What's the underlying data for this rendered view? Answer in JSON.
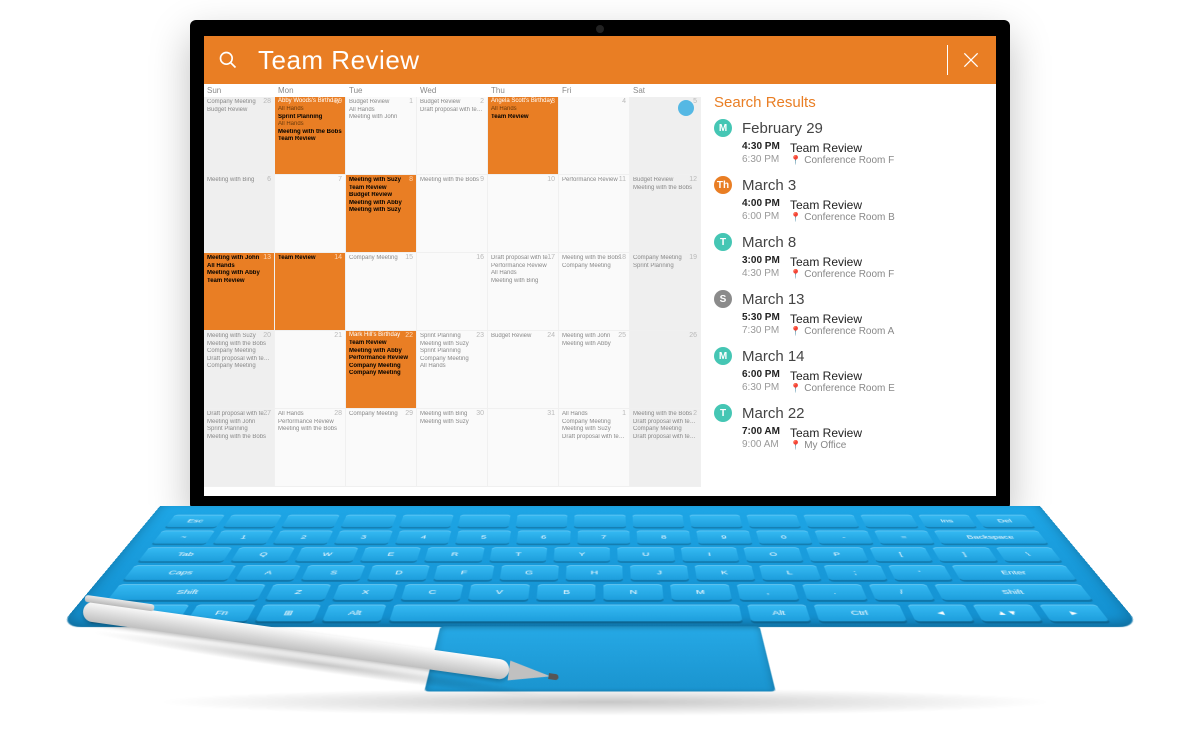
{
  "search": {
    "value": "Team Review"
  },
  "calendar": {
    "dayHeaders": [
      "Sun",
      "Mon",
      "Tue",
      "Wed",
      "Thu",
      "Fri",
      "Sat"
    ],
    "weeks": [
      [
        {
          "n": "28",
          "wknd": true,
          "hl": false,
          "events": [
            {
              "t": "Company Meeting"
            },
            {
              "t": "Budget Review"
            }
          ]
        },
        {
          "n": "29",
          "hl": true,
          "banner": "Abby Woods's Birthday",
          "events": [
            {
              "t": "All Hands"
            },
            {
              "t": "Sprint Planning",
              "hit": true
            },
            {
              "t": "All Hands"
            },
            {
              "t": "Meeting with the Bobs",
              "hit": true
            },
            {
              "t": "Team Review",
              "hit": true
            }
          ]
        },
        {
          "n": "1",
          "events": [
            {
              "t": "Budget Review"
            },
            {
              "t": "All Hands"
            },
            {
              "t": "Meeting with John"
            }
          ]
        },
        {
          "n": "2",
          "events": [
            {
              "t": "Budget Review"
            },
            {
              "t": "Draft proposal with team"
            }
          ]
        },
        {
          "n": "3",
          "hl": true,
          "banner": "Angela Scott's Birthday",
          "events": [
            {
              "t": "All Hands"
            },
            {
              "t": "Team Review",
              "hit": true
            }
          ]
        },
        {
          "n": "4",
          "events": []
        },
        {
          "n": "5",
          "wknd": true,
          "today": true,
          "events": []
        }
      ],
      [
        {
          "n": "6",
          "wknd": true,
          "events": [
            {
              "t": "Meeting with Bing"
            }
          ]
        },
        {
          "n": "7",
          "events": []
        },
        {
          "n": "8",
          "hl": true,
          "events": [
            {
              "t": "Meeting with Suzy",
              "hit": true
            },
            {
              "t": "Team Review",
              "hit": true
            },
            {
              "t": "Budget Review",
              "hit": true
            },
            {
              "t": "Meeting with Abby",
              "hit": true
            },
            {
              "t": "Meeting with Suzy",
              "hit": true
            }
          ]
        },
        {
          "n": "9",
          "events": [
            {
              "t": "Meeting with the Bobs"
            }
          ]
        },
        {
          "n": "10",
          "events": []
        },
        {
          "n": "11",
          "events": [
            {
              "t": "Performance Review"
            }
          ]
        },
        {
          "n": "12",
          "wknd": true,
          "events": [
            {
              "t": "Budget Review"
            },
            {
              "t": "Meeting with the Bobs"
            }
          ]
        }
      ],
      [
        {
          "n": "13",
          "wknd": true,
          "hl": true,
          "events": [
            {
              "t": "Meeting with John",
              "hit": true
            },
            {
              "t": "All Hands",
              "hit": true
            },
            {
              "t": "Meeting with Abby",
              "hit": true
            },
            {
              "t": "Team Review",
              "hit": true
            }
          ]
        },
        {
          "n": "14",
          "hl": true,
          "events": [
            {
              "t": "Team Review",
              "hit": true
            }
          ]
        },
        {
          "n": "15",
          "events": [
            {
              "t": "Company Meeting"
            }
          ]
        },
        {
          "n": "16",
          "events": []
        },
        {
          "n": "17",
          "events": [
            {
              "t": "Draft proposal with team"
            },
            {
              "t": "Performance Review"
            },
            {
              "t": "All Hands"
            },
            {
              "t": "Meeting with Bing"
            }
          ]
        },
        {
          "n": "18",
          "events": [
            {
              "t": "Meeting with the Bobs"
            },
            {
              "t": "Company Meeting"
            }
          ]
        },
        {
          "n": "19",
          "wknd": true,
          "events": [
            {
              "t": "Company Meeting"
            },
            {
              "t": "Sprint Planning"
            }
          ]
        }
      ],
      [
        {
          "n": "20",
          "wknd": true,
          "events": [
            {
              "t": "Meeting with Suzy"
            },
            {
              "t": "Meeting with the Bobs"
            },
            {
              "t": "Company Meeting"
            },
            {
              "t": "Draft proposal with team"
            },
            {
              "t": "Company Meeting"
            }
          ]
        },
        {
          "n": "21",
          "events": []
        },
        {
          "n": "22",
          "hl": true,
          "banner": "Mark Hill's Birthday",
          "events": [
            {
              "t": "Team Review",
              "hit": true
            },
            {
              "t": "Meeting with Abby",
              "hit": true
            },
            {
              "t": "Performance Review",
              "hit": true
            },
            {
              "t": "Company Meeting",
              "hit": true
            },
            {
              "t": "Company Meeting",
              "hit": true
            }
          ]
        },
        {
          "n": "23",
          "events": [
            {
              "t": "Sprint Planning"
            },
            {
              "t": "Meeting with Suzy"
            },
            {
              "t": "Sprint Planning"
            },
            {
              "t": "Company Meeting"
            },
            {
              "t": "All Hands"
            }
          ]
        },
        {
          "n": "24",
          "events": [
            {
              "t": "Budget Review"
            }
          ]
        },
        {
          "n": "25",
          "events": [
            {
              "t": "Meeting with John"
            },
            {
              "t": "Meeting with Abby"
            }
          ]
        },
        {
          "n": "26",
          "wknd": true,
          "events": []
        }
      ],
      [
        {
          "n": "27",
          "wknd": true,
          "events": [
            {
              "t": "Draft proposal with team"
            },
            {
              "t": "Meeting with John"
            },
            {
              "t": "Sprint Planning"
            },
            {
              "t": "Meeting with the Bobs"
            }
          ]
        },
        {
          "n": "28",
          "events": [
            {
              "t": "All Hands"
            },
            {
              "t": "Performance Review"
            },
            {
              "t": "Meeting with the Bobs"
            }
          ]
        },
        {
          "n": "29",
          "events": [
            {
              "t": "Company Meeting"
            }
          ]
        },
        {
          "n": "30",
          "events": [
            {
              "t": "Meeting with Bing"
            },
            {
              "t": "Meeting with Suzy"
            }
          ]
        },
        {
          "n": "31",
          "events": []
        },
        {
          "n": "1",
          "events": [
            {
              "t": "All Hands"
            },
            {
              "t": "Company Meeting"
            },
            {
              "t": "Meeting with Suzy"
            },
            {
              "t": "Draft proposal with team"
            }
          ]
        },
        {
          "n": "2",
          "wknd": true,
          "events": [
            {
              "t": "Meeting with the Bobs"
            },
            {
              "t": "Draft proposal with team"
            },
            {
              "t": "Company Meeting"
            },
            {
              "t": "Draft proposal with team"
            }
          ]
        }
      ]
    ]
  },
  "results": {
    "heading": "Search Results",
    "days": [
      {
        "badge": "M",
        "color": "#45c6b4",
        "date": "February 29",
        "items": [
          {
            "t1": "4:30 PM",
            "t2": "6:30 PM",
            "title": "Team Review",
            "loc": "Conference Room F"
          }
        ]
      },
      {
        "badge": "Th",
        "color": "#e97e24",
        "date": "March 3",
        "items": [
          {
            "t1": "4:00 PM",
            "t2": "6:00 PM",
            "title": "Team Review",
            "loc": "Conference Room B"
          }
        ]
      },
      {
        "badge": "T",
        "color": "#45c6b4",
        "date": "March 8",
        "items": [
          {
            "t1": "3:00 PM",
            "t2": "4:30 PM",
            "title": "Team Review",
            "loc": "Conference Room F"
          }
        ]
      },
      {
        "badge": "S",
        "color": "#8b8b8b",
        "date": "March 13",
        "items": [
          {
            "t1": "5:30 PM",
            "t2": "7:30 PM",
            "title": "Team Review",
            "loc": "Conference Room A"
          }
        ]
      },
      {
        "badge": "M",
        "color": "#45c6b4",
        "date": "March 14",
        "items": [
          {
            "t1": "6:00 PM",
            "t2": "6:30 PM",
            "title": "Team Review",
            "loc": "Conference Room E"
          }
        ]
      },
      {
        "badge": "T",
        "color": "#45c6b4",
        "date": "March 22",
        "items": [
          {
            "t1": "7:00 AM",
            "t2": "9:00 AM",
            "title": "Team Review",
            "loc": "My Office"
          }
        ]
      }
    ]
  },
  "kb": {
    "rows": [
      [
        "Esc",
        "",
        "",
        "",
        "",
        "",
        "",
        "",
        "",
        "",
        "",
        "",
        "",
        "Ins",
        "Del"
      ],
      [
        "~",
        "1",
        "2",
        "3",
        "4",
        "5",
        "6",
        "7",
        "8",
        "9",
        "0",
        "-",
        "=",
        "Backspace"
      ],
      [
        "Tab",
        "Q",
        "W",
        "E",
        "R",
        "T",
        "Y",
        "U",
        "I",
        "O",
        "P",
        "[",
        "]",
        "\\"
      ],
      [
        "Caps",
        "A",
        "S",
        "D",
        "F",
        "G",
        "H",
        "J",
        "K",
        "L",
        ";",
        "'",
        "Enter"
      ],
      [
        "Shift",
        "Z",
        "X",
        "C",
        "V",
        "B",
        "N",
        "M",
        ",",
        ".",
        "/",
        "Shift"
      ],
      [
        "Ctrl",
        "Fn",
        "⊞",
        "Alt",
        "",
        "Alt",
        "Ctrl",
        "◄",
        "▲▼",
        "►"
      ]
    ]
  }
}
